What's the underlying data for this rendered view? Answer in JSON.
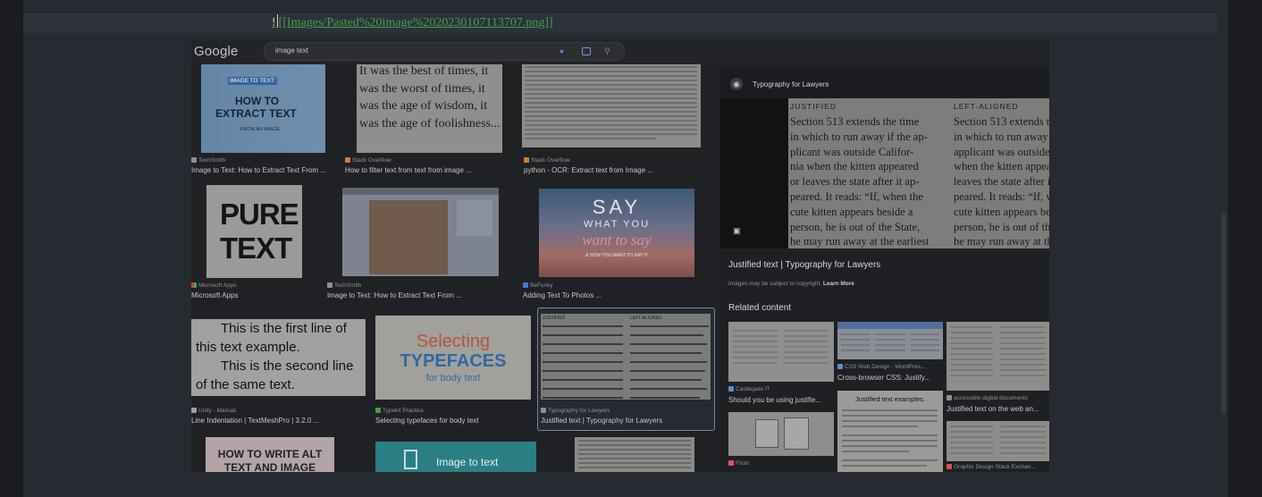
{
  "markdown": {
    "bang": "!",
    "link": "[[Images/Pasted%20image%2020230107113707.png]]"
  },
  "google": {
    "logo": "Google",
    "query": "image text"
  },
  "results": [
    {
      "source": "TechSmith",
      "title": "Image to Text: How to Extract Text From ..."
    },
    {
      "source": "Stack Overflow",
      "title": "How to filter text from text from image ..."
    },
    {
      "source": "Stack Overflow",
      "title": "python - OCR: Extract text from Image ..."
    },
    {
      "source": "Microsoft Apps",
      "title": "Microsoft Apps"
    },
    {
      "source": "TechSmith",
      "title": "Image to Text: How to Extract Text From ..."
    },
    {
      "source": "BeFunky",
      "title": "Adding Text To Photos ..."
    },
    {
      "source": "Unity - Manual",
      "title": "Line Indentation | TextMeshPro | 3.2.0 ..."
    },
    {
      "source": "Typekit Practice",
      "title": "Selecting typefaces for body text"
    },
    {
      "source": "Typography for Lawyers",
      "title": "Justified text | Typography for Lawyers"
    }
  ],
  "thumbs": {
    "techsmith_badge": "IMAGE TO TEXT:",
    "techsmith_l1": "HOW TO",
    "techsmith_l2": "EXTRACT TEXT",
    "techsmith_l3": "FROM AN IMAGE",
    "dickens": "It was the best of times, it was the worst of times, it was the age of wisdom, it was the age of foolishness...",
    "pure1": "PURE",
    "pure2": "TEXT",
    "say1": "SAY",
    "say2": "WHAT YOU",
    "say3": "want to say",
    "say4": "& HOW YOU WANT TO SAY IT",
    "unity1": "This is the first line of",
    "unity2": "this text example.",
    "unity3": "This is the second line",
    "unity4": "of the same text.",
    "typeface1": "Selecting",
    "typeface2": "TYPEFACES",
    "typeface3": "for body text",
    "alt1": "HOW TO WRITE ALT",
    "alt2": "TEXT AND IMAGE",
    "img2text": "Image to text",
    "just_label": "JUSTIFIED",
    "left_label": "LEFT-ALIGNED"
  },
  "panel": {
    "site": "Typography for Lawyers",
    "heading_justified": "JUSTIFIED",
    "heading_left": "LEFT-ALIGNED",
    "justified_lines": [
      "Section 513 extends the time",
      "in which to run away if the ap-",
      "plicant was outside Califor-",
      "nia when the kitten appeared",
      "or leaves the state after it ap-",
      "peared. It reads: “If, when the",
      "cute kitten appears beside a",
      "person, he is out of the State,",
      "he may run away at the earliest"
    ],
    "left_lines": [
      "Section 513 extends the",
      "in which to run away if",
      "applicant was outside C",
      "when the kitten appeare",
      "leaves the state after it",
      "peared. It reads: “If, w",
      "cute kitten appears besi",
      "person, he is out of the",
      "he may run away at the"
    ],
    "title": "Justified text | Typography for Lawyers",
    "copyright": "Images may be subject to copyright.",
    "learn_more": "Learn More",
    "related_heading": "Related content",
    "related": [
      {
        "source": "Castlegate IT",
        "title": "Should you be using justifie..."
      },
      {
        "source": "CSS Web Design - WordPres...",
        "title": "Cross-browser CSS: Justify..."
      },
      {
        "source": "accessible digital documents",
        "title": "Justified text on the web an..."
      },
      {
        "source": "Flickr",
        "title": ""
      },
      {
        "source": "",
        "title": "Justified text examples."
      },
      {
        "source": "Graphic Design Stack Exchan...",
        "title": ""
      }
    ]
  }
}
